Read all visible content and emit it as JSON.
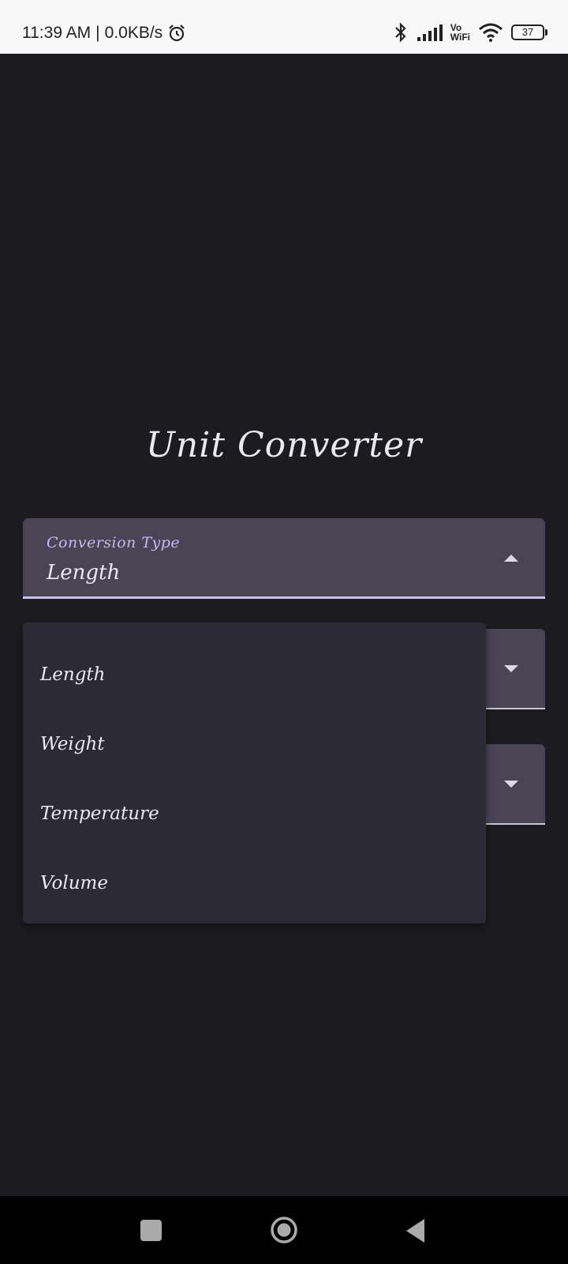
{
  "status_bar": {
    "time": "11:39 AM",
    "separator": "|",
    "network_speed": "0.0KB/s",
    "vowifi_top": "Vo",
    "vowifi_bottom": "WiFi",
    "battery": "37",
    "icons": [
      "alarm-icon",
      "bluetooth-icon",
      "signal-icon",
      "wifi-icon",
      "battery-icon"
    ]
  },
  "app": {
    "title": "Unit Converter",
    "conversion_field": {
      "label": "Conversion Type",
      "value": "Length",
      "expanded": true
    },
    "menu": {
      "items": [
        {
          "label": "Length"
        },
        {
          "label": "Weight"
        },
        {
          "label": "Temperature"
        },
        {
          "label": "Volume"
        }
      ]
    }
  },
  "nav_bar": {
    "icons": [
      "recents-icon",
      "home-icon",
      "back-icon"
    ]
  },
  "colors": {
    "background": "#1c1b20",
    "field": "#4a4555",
    "accent": "#cfc0f3",
    "menu": "#2c2a34"
  }
}
